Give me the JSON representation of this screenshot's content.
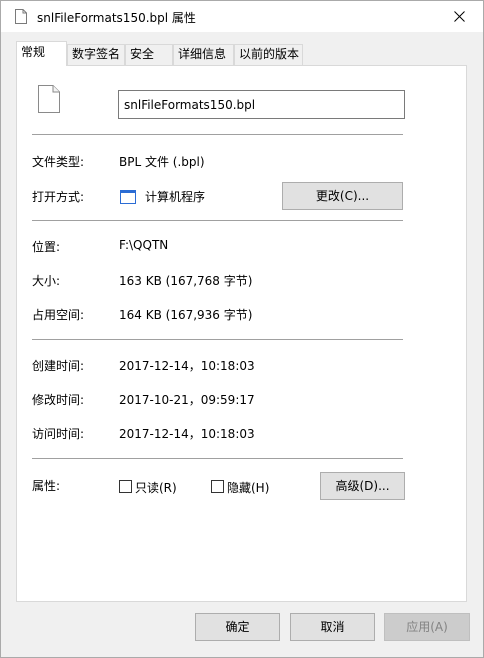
{
  "window": {
    "title": "snlFileFormats150.bpl 属性"
  },
  "tabs": [
    {
      "label": "常规",
      "active": true
    },
    {
      "label": "数字签名",
      "active": false
    },
    {
      "label": "安全",
      "active": false
    },
    {
      "label": "详细信息",
      "active": false
    },
    {
      "label": "以前的版本",
      "active": false
    }
  ],
  "general": {
    "filename": "snlFileFormats150.bpl",
    "file_type_label": "文件类型:",
    "file_type_value": "BPL 文件 (.bpl)",
    "open_with_label": "打开方式:",
    "open_with_value": "计算机程序",
    "change_button": "更改(C)...",
    "location_label": "位置:",
    "location_value": "F:\\QQTN",
    "size_label": "大小:",
    "size_value": "163 KB (167,768 字节)",
    "size_on_disk_label": "占用空间:",
    "size_on_disk_value": "164 KB (167,936 字节)",
    "created_label": "创建时间:",
    "created_value": "2017-12-14，10:18:03",
    "modified_label": "修改时间:",
    "modified_value": "2017-10-21，09:59:17",
    "accessed_label": "访问时间:",
    "accessed_value": "2017-12-14，10:18:03",
    "attributes_label": "属性:",
    "readonly_label": "只读(R)",
    "hidden_label": "隐藏(H)",
    "advanced_button": "高级(D)..."
  },
  "footer": {
    "ok": "确定",
    "cancel": "取消",
    "apply": "应用(A)"
  },
  "icons": {
    "title": "document-icon",
    "file": "document-icon",
    "app": "window-app-icon",
    "close": "close-icon"
  },
  "colors": {
    "button_face": "#e1e1e1",
    "button_border": "#adadad",
    "disabled_text": "#838383",
    "app_icon_blue": "#2b6cd4"
  }
}
